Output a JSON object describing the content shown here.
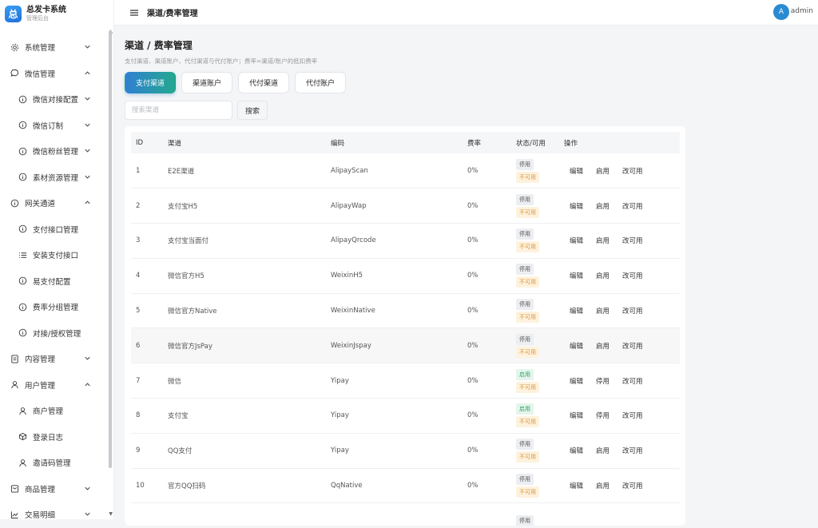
{
  "brand": {
    "title": "总发卡系统",
    "subtitle": "管理后台",
    "logo_char": "总"
  },
  "topbar": {
    "title": "渠道/费率管理",
    "user_initial": "A",
    "user_name": "admin"
  },
  "sidebar": {
    "items": [
      {
        "label": "系统管理",
        "icon": "gear-icon",
        "level": 1,
        "arrow": "down"
      },
      {
        "label": "微信管理",
        "icon": "chat-icon",
        "level": 1,
        "arrow": "up"
      },
      {
        "label": "微信对接配置",
        "icon": "info-icon",
        "level": 2,
        "arrow": "down"
      },
      {
        "label": "微信订制",
        "icon": "info-icon",
        "level": 2,
        "arrow": "down"
      },
      {
        "label": "微信粉丝管理",
        "icon": "info-icon",
        "level": 2,
        "arrow": "down"
      },
      {
        "label": "素材资源管理",
        "icon": "info-icon",
        "level": 2,
        "arrow": "down"
      },
      {
        "label": "网关通道",
        "icon": "info-icon",
        "level": 1,
        "arrow": "up"
      },
      {
        "label": "支付接口管理",
        "icon": "info-icon",
        "level": 2,
        "arrow": ""
      },
      {
        "label": "安装支付接口",
        "icon": "list-icon",
        "level": 2,
        "arrow": ""
      },
      {
        "label": "易支付配置",
        "icon": "info-icon",
        "level": 2,
        "arrow": ""
      },
      {
        "label": "费率分组管理",
        "icon": "info-icon",
        "level": 2,
        "arrow": ""
      },
      {
        "label": "对接/授权管理",
        "icon": "info-icon",
        "level": 2,
        "arrow": ""
      },
      {
        "label": "内容管理",
        "icon": "document-icon",
        "level": 1,
        "arrow": "down"
      },
      {
        "label": "用户管理",
        "icon": "user-icon",
        "level": 1,
        "arrow": "up"
      },
      {
        "label": "商户管理",
        "icon": "user-icon",
        "level": 2,
        "arrow": ""
      },
      {
        "label": "登录日志",
        "icon": "cube-icon",
        "level": 2,
        "arrow": ""
      },
      {
        "label": "邀请码管理",
        "icon": "user-icon",
        "level": 2,
        "arrow": ""
      },
      {
        "label": "商品管理",
        "icon": "bag-icon",
        "level": 1,
        "arrow": "down"
      },
      {
        "label": "交易明细",
        "icon": "chart-icon",
        "level": 1,
        "arrow": "down"
      }
    ]
  },
  "page": {
    "title": "渠道 / 费率管理",
    "description": "支付渠道、渠道账户、代付渠道与代付账户；费率=渠道/账户的抵扣费率",
    "tabs": [
      "支付渠道",
      "渠道账户",
      "代付渠道",
      "代付账户"
    ],
    "search_placeholder": "搜索渠道",
    "search_button": "搜索"
  },
  "table": {
    "columns": [
      "ID",
      "渠道",
      "编码",
      "费率",
      "状态/可用",
      "操作"
    ],
    "rows": [
      {
        "id": "1",
        "channel": "E2E渠道",
        "code": "AlipayScan",
        "fee": "0%",
        "status": "停用",
        "status_type": "stop",
        "avail": "不可用",
        "a1": "编辑",
        "a2": "启用",
        "a3": "改可用"
      },
      {
        "id": "2",
        "channel": "支付宝H5",
        "code": "AlipayWap",
        "fee": "0%",
        "status": "停用",
        "status_type": "stop",
        "avail": "不可用",
        "a1": "编辑",
        "a2": "启用",
        "a3": "改可用"
      },
      {
        "id": "3",
        "channel": "支付宝当面付",
        "code": "AlipayQrcode",
        "fee": "0%",
        "status": "停用",
        "status_type": "stop",
        "avail": "不可用",
        "a1": "编辑",
        "a2": "启用",
        "a3": "改可用"
      },
      {
        "id": "4",
        "channel": "微信官方H5",
        "code": "WeixinH5",
        "fee": "0%",
        "status": "停用",
        "status_type": "stop",
        "avail": "不可用",
        "a1": "编辑",
        "a2": "启用",
        "a3": "改可用"
      },
      {
        "id": "5",
        "channel": "微信官方Native",
        "code": "WeixinNative",
        "fee": "0%",
        "status": "停用",
        "status_type": "stop",
        "avail": "不可用",
        "a1": "编辑",
        "a2": "启用",
        "a3": "改可用"
      },
      {
        "id": "6",
        "channel": "微信官方JsPay",
        "code": "WeixinJspay",
        "fee": "0%",
        "status": "停用",
        "status_type": "stop",
        "avail": "不可用",
        "a1": "编辑",
        "a2": "启用",
        "a3": "改可用"
      },
      {
        "id": "7",
        "channel": "微信",
        "code": "Yipay",
        "fee": "0%",
        "status": "启用",
        "status_type": "on",
        "avail": "不可用",
        "a1": "编辑",
        "a2": "停用",
        "a3": "改可用"
      },
      {
        "id": "8",
        "channel": "支付宝",
        "code": "Yipay",
        "fee": "0%",
        "status": "启用",
        "status_type": "on",
        "avail": "不可用",
        "a1": "编辑",
        "a2": "停用",
        "a3": "改可用"
      },
      {
        "id": "9",
        "channel": "QQ支付",
        "code": "Yipay",
        "fee": "0%",
        "status": "停用",
        "status_type": "stop",
        "avail": "不可用",
        "a1": "编辑",
        "a2": "启用",
        "a3": "改可用"
      },
      {
        "id": "10",
        "channel": "官方QQ扫码",
        "code": "QqNative",
        "fee": "0%",
        "status": "停用",
        "status_type": "stop",
        "avail": "不可用",
        "a1": "编辑",
        "a2": "启用",
        "a3": "改可用"
      },
      {
        "id": "",
        "channel": "",
        "code": "",
        "fee": "",
        "status": "停用",
        "status_type": "stop",
        "avail": "",
        "a1": "",
        "a2": "",
        "a3": ""
      }
    ]
  },
  "colors": {
    "accent_start": "#2f80d1",
    "accent_end": "#24a88f",
    "avatar": "#2a8bd2"
  }
}
